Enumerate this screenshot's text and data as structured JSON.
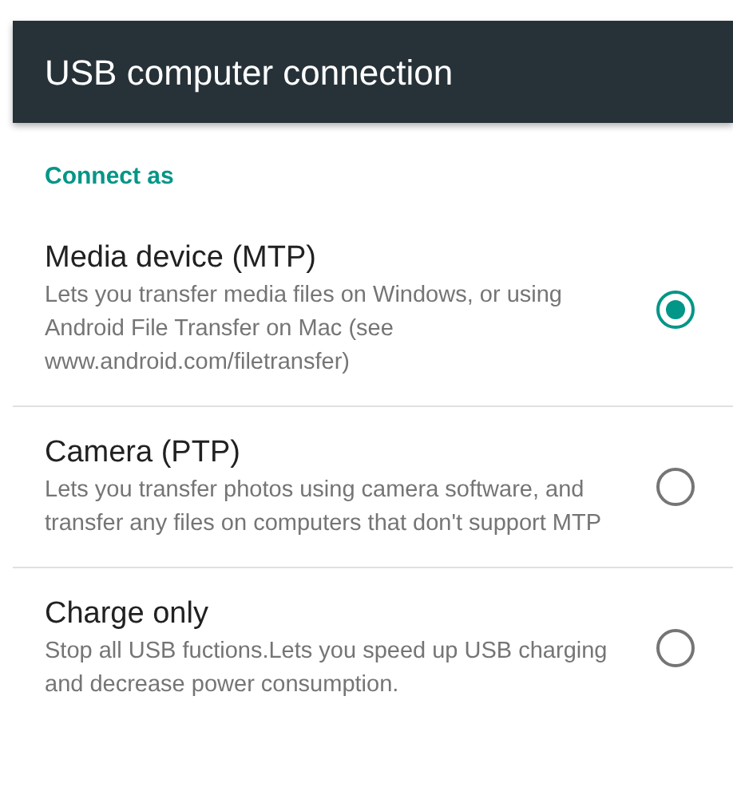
{
  "header": {
    "title": "USB computer connection"
  },
  "section": {
    "title": "Connect as"
  },
  "options": [
    {
      "title": "Media device (MTP)",
      "description": "Lets you transfer media files on Windows, or using Android File Transfer on Mac (see www.android.com/filetransfer)",
      "selected": true
    },
    {
      "title": "Camera (PTP)",
      "description": "Lets you transfer photos using camera software, and transfer any files on computers that don't support MTP",
      "selected": false
    },
    {
      "title": "Charge only",
      "description": "Stop all USB fuctions.Lets you speed up USB charging and decrease power consumption.",
      "selected": false
    }
  ]
}
